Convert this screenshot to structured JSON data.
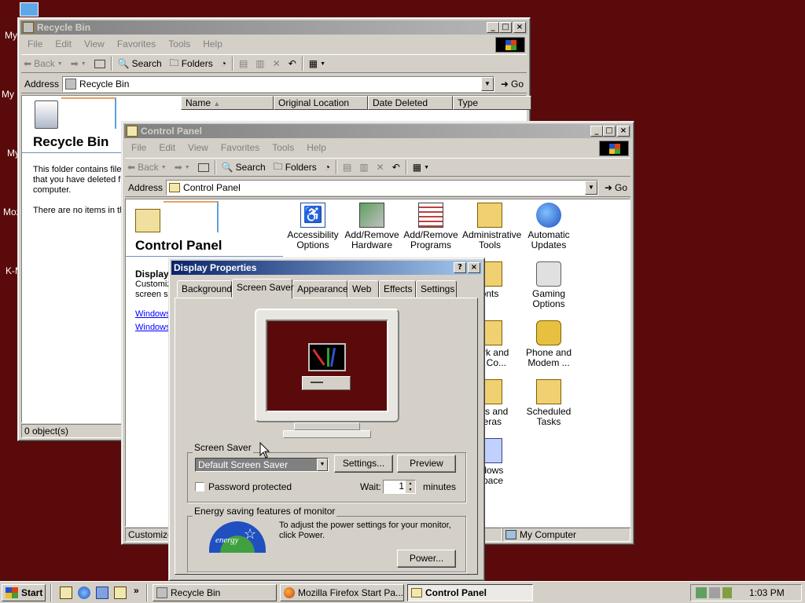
{
  "desktop": {
    "icon_labels": [
      "My",
      "My D",
      "My",
      "Moz",
      "K-M"
    ]
  },
  "recycle_bin": {
    "title": "Recycle Bin",
    "menu": [
      "File",
      "Edit",
      "View",
      "Favorites",
      "Tools",
      "Help"
    ],
    "toolbar": {
      "back": "Back",
      "search": "Search",
      "folders": "Folders"
    },
    "address_label": "Address",
    "address_value": "Recycle Bin",
    "go_label": "Go",
    "columns": [
      "Name",
      "Original Location",
      "Date Deleted",
      "Type"
    ],
    "heading": "Recycle Bin",
    "info_line1": "This folder contains files",
    "info_line2": "that you have deleted fr",
    "info_line3": "computer.",
    "empty_msg": "There are no items in the",
    "status": "0 object(s)"
  },
  "control_panel": {
    "title": "Control Panel",
    "menu": [
      "File",
      "Edit",
      "View",
      "Favorites",
      "Tools",
      "Help"
    ],
    "toolbar": {
      "back": "Back",
      "search": "Search",
      "folders": "Folders"
    },
    "address_label": "Address",
    "address_value": "Control Panel",
    "go_label": "Go",
    "heading": "Control Panel",
    "sidebar_title": "Display",
    "sidebar_desc1": "Customiz",
    "sidebar_desc2": "screen sa",
    "sidebar_link1": "Windows",
    "sidebar_link2": "Windows",
    "status_left": "Customizes",
    "status_right": "My Computer",
    "icons": [
      {
        "l1": "Accessibility",
        "l2": "Options"
      },
      {
        "l1": "Add/Remove",
        "l2": "Hardware"
      },
      {
        "l1": "Add/Remove",
        "l2": "Programs"
      },
      {
        "l1": "Administrative",
        "l2": "Tools"
      },
      {
        "l1": "Automatic",
        "l2": "Updates"
      },
      {
        "l1": "onts",
        "l2": ""
      },
      {
        "l1": "Gaming",
        "l2": "Options"
      },
      {
        "l1": "work and",
        "l2": "up Co..."
      },
      {
        "l1": "Phone and",
        "l2": "Modem ..."
      },
      {
        "l1": "ners and",
        "l2": "neras"
      },
      {
        "l1": "Scheduled",
        "l2": "Tasks"
      },
      {
        "l1": "ndows",
        "l2": "Space"
      }
    ]
  },
  "display_properties": {
    "title": "Display Properties",
    "tabs": [
      "Background",
      "Screen Saver",
      "Appearance",
      "Web",
      "Effects",
      "Settings"
    ],
    "selected_tab": "Screen Saver",
    "group_screensaver": "Screen Saver",
    "screensaver_value": "Default Screen Saver",
    "settings_btn": "Settings...",
    "preview_btn": "Preview",
    "password_label": "Password protected",
    "password_checked": false,
    "wait_label": "Wait:",
    "wait_value": "1",
    "minutes_label": "minutes",
    "group_energy": "Energy saving features of monitor",
    "energy_text1": "To adjust the power settings for your monitor,",
    "energy_text2": "click Power.",
    "power_btn": "Power...",
    "energy_logo_text": "energy"
  },
  "taskbar": {
    "start": "Start",
    "tasks": [
      "Recycle Bin",
      "Mozilla Firefox Start Pa...",
      "Control Panel"
    ],
    "active_task": "Control Panel",
    "clock": "1:03 PM"
  },
  "colors": {
    "desktop": "#5a0a0a",
    "title_active": "#0a246a",
    "title_inactive": "#808080",
    "face": "#d4d0c8"
  }
}
